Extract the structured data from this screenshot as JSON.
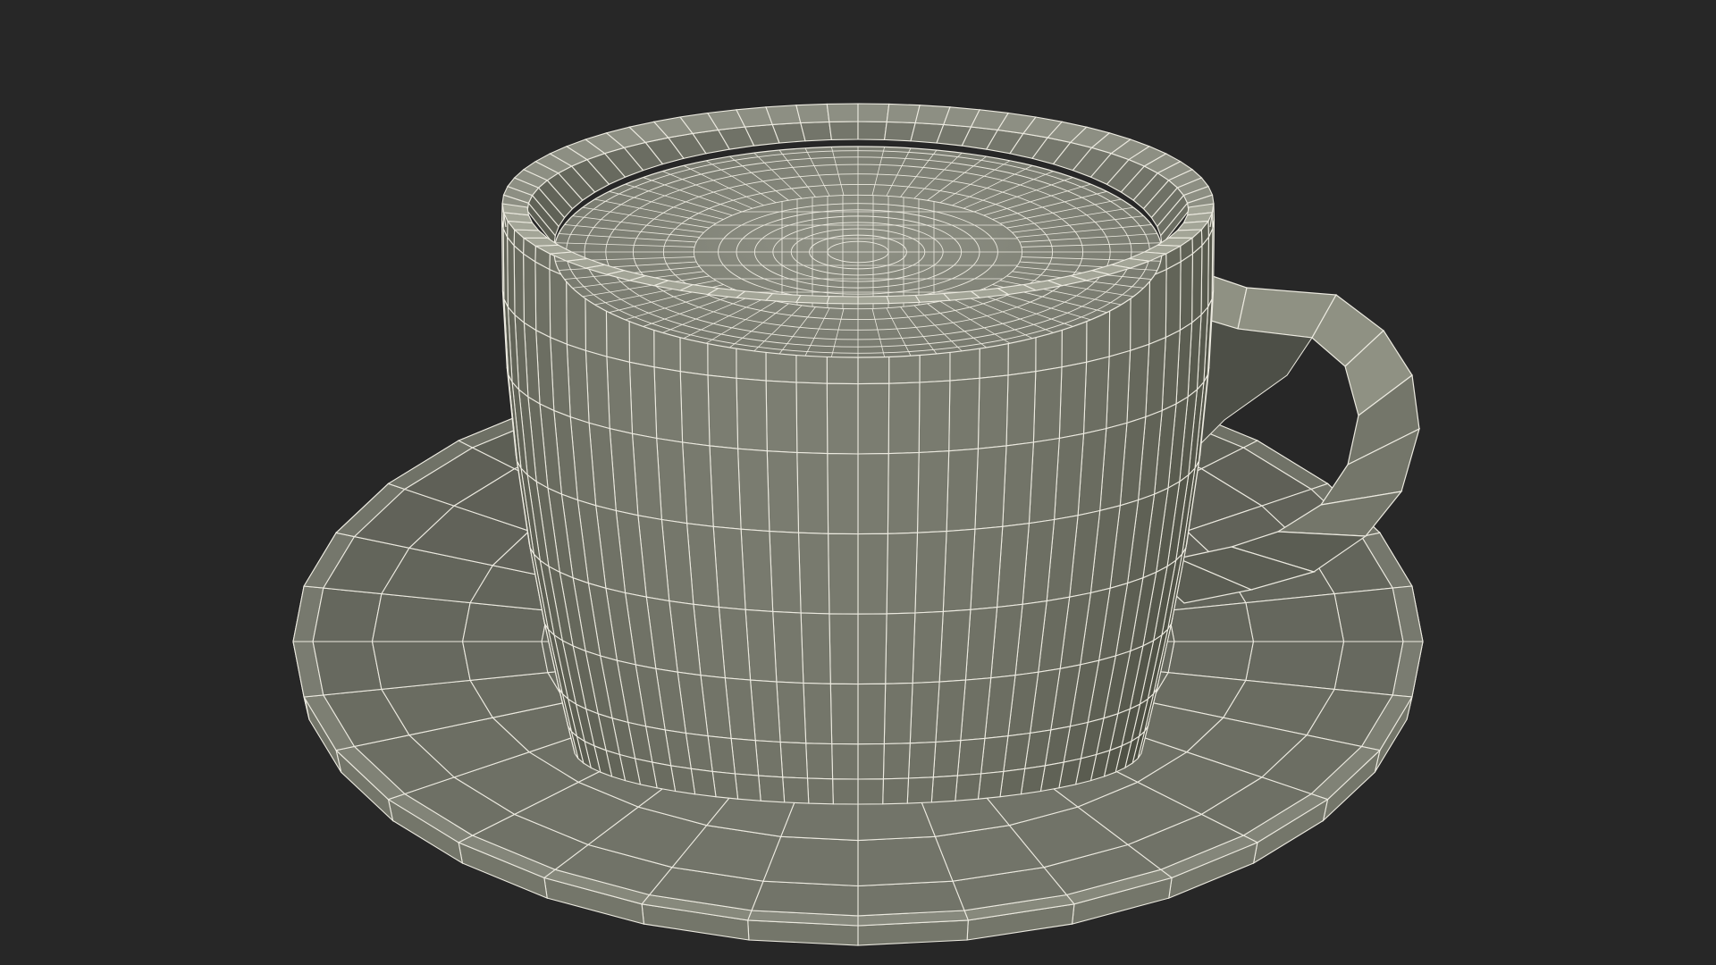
{
  "scene": {
    "subject": "cup-and-saucer-wireframe",
    "colors": {
      "background": "#272727",
      "surface_light": "#8f9183",
      "surface_mid": "#74766a",
      "surface_dark": "#5b5d53",
      "coffee_surface": "#8a8c80",
      "inner_wall": "#6f7166",
      "wire": "#eceae0"
    }
  }
}
